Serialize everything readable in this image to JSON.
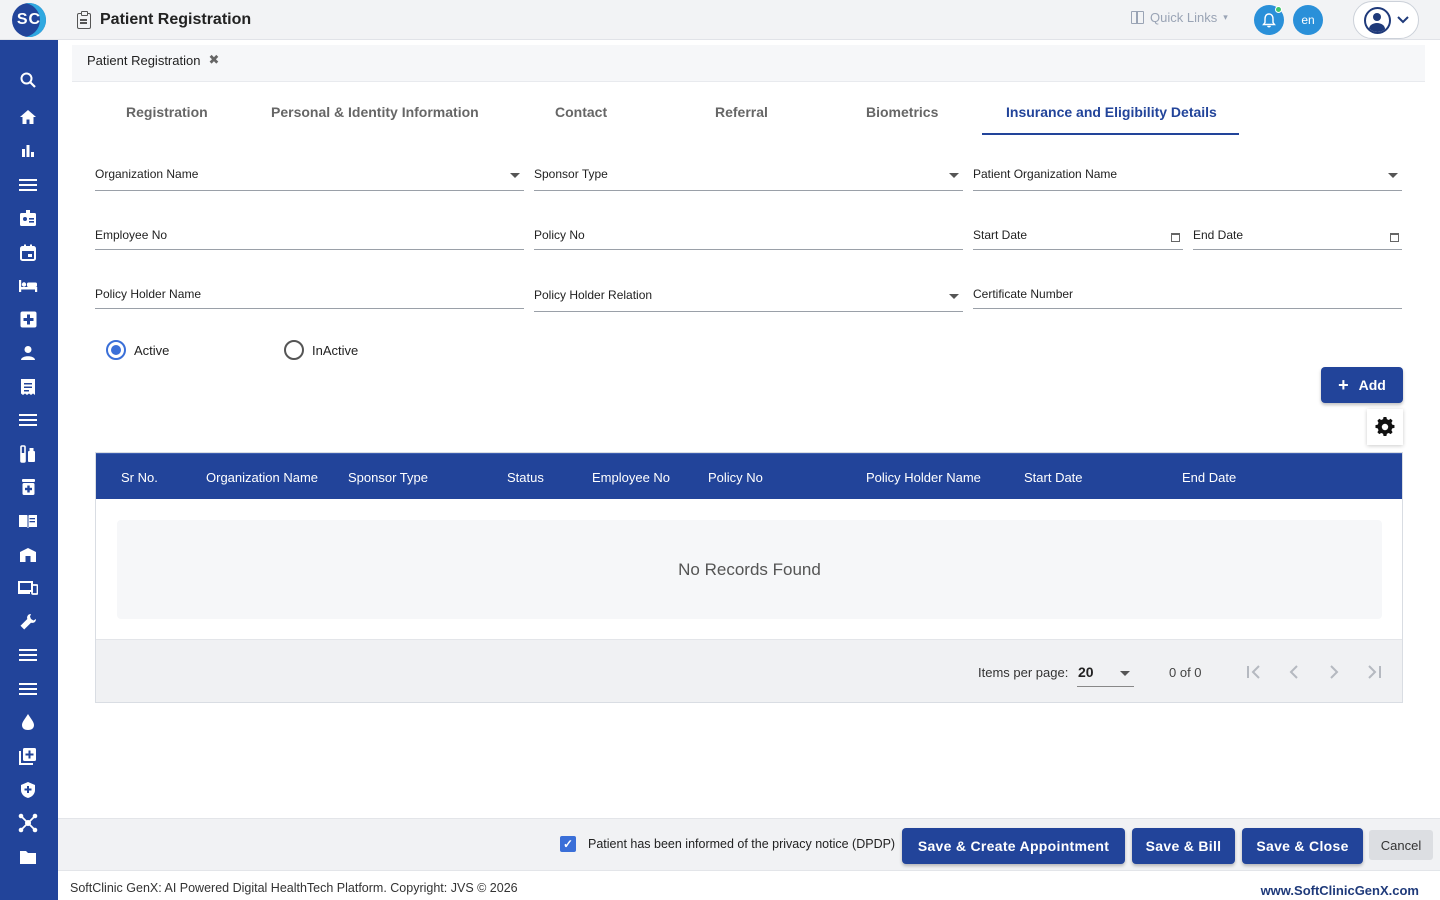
{
  "header": {
    "logo_text": "SC",
    "title": "Patient Registration",
    "quick_links": "Quick Links",
    "lang": "en"
  },
  "sidebar": {
    "icons": [
      "search-icon",
      "home-icon",
      "bar-chart-icon",
      "menu-icon",
      "badge-icon",
      "calendar-icon",
      "bed-icon",
      "medical-plus-icon",
      "person-icon",
      "receipt-icon",
      "list-icon",
      "lab-icon",
      "pharmacy-icon",
      "book-icon",
      "building-icon",
      "devices-icon",
      "wrench-icon",
      "menu-icon",
      "menu-icon",
      "blood-drop-icon",
      "add-box-icon",
      "shield-icon",
      "network-icon",
      "folder-icon"
    ]
  },
  "breadcrumb": {
    "tab_label": "Patient Registration",
    "close": "✖"
  },
  "tabs": [
    {
      "label": "Registration"
    },
    {
      "label": "Personal & Identity Information"
    },
    {
      "label": "Contact"
    },
    {
      "label": "Referral"
    },
    {
      "label": "Biometrics"
    },
    {
      "label": "Insurance and Eligibility Details"
    }
  ],
  "form": {
    "organization_name": "Organization Name",
    "sponsor_type": "Sponsor Type",
    "patient_organization_name": "Patient Organization Name",
    "employee_no": "Employee No",
    "policy_no": "Policy No",
    "start_date": "Start Date",
    "end_date": "End Date",
    "policy_holder_name": "Policy Holder Name",
    "policy_holder_relation": "Policy Holder Relation",
    "certificate_number": "Certificate Number",
    "status_active": "Active",
    "status_inactive": "InActive",
    "add_label": "Add"
  },
  "table": {
    "columns": [
      "Sr No.",
      "Organization Name",
      "Sponsor Type",
      "Status",
      "Employee No",
      "Policy No",
      "Policy Holder Name",
      "Start Date",
      "End Date"
    ],
    "empty_text": "No Records Found",
    "items_per_page_label": "Items per page:",
    "items_per_page": "20",
    "range": "0 of 0"
  },
  "footer": {
    "dpdp_label": "Patient has been informed of the privacy notice (DPDP)",
    "save_create_appointment": "Save & Create Appointment",
    "save_bill": "Save & Bill",
    "save_close": "Save & Close",
    "cancel": "Cancel",
    "copyright": "SoftClinic GenX: AI Powered Digital HealthTech Platform. Copyright: JVS © 2026",
    "website": "www.SoftClinicGenX.com"
  },
  "colors": {
    "primary": "#22449a",
    "accent": "#2a90d9",
    "radio": "#3a6fd8"
  }
}
